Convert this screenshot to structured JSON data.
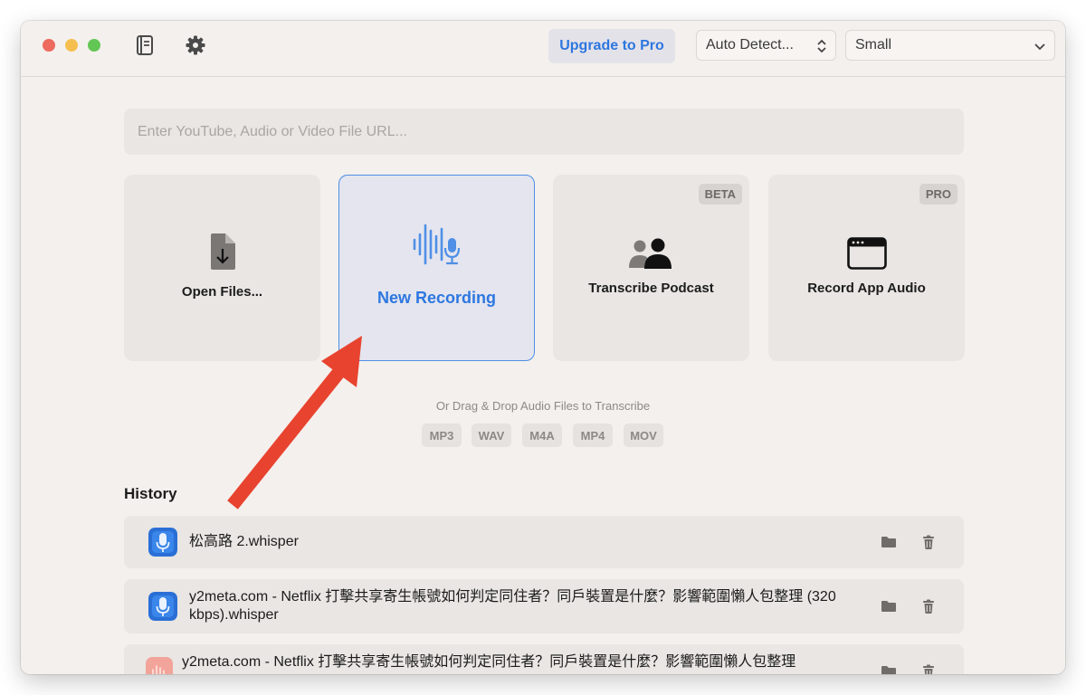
{
  "toolbar": {
    "upgrade_label": "Upgrade to Pro",
    "language_select": "Auto Detect...",
    "model_select": "Small"
  },
  "url_input": {
    "placeholder": "Enter YouTube, Audio or Video File URL..."
  },
  "cards": [
    {
      "label": "Open Files...",
      "icon": "file-download-icon"
    },
    {
      "label": "New Recording",
      "icon": "waveform-mic-icon"
    },
    {
      "label": "Transcribe Podcast",
      "icon": "people-icon",
      "badge": "BETA"
    },
    {
      "label": "Record App Audio",
      "icon": "app-window-icon",
      "badge": "PRO"
    }
  ],
  "drag_hint": "Or Drag & Drop Audio Files to Transcribe",
  "formats": [
    "MP3",
    "WAV",
    "M4A",
    "MP4",
    "MOV"
  ],
  "history": {
    "title": "History",
    "items": [
      {
        "name": "松高路 2.whisper"
      },
      {
        "name": "y2meta.com - Netflix 打擊共享寄生帳號如何判定同住者？同戶裝置是什麼？影響範圍懶人包整理 (320 kbps).whisper"
      },
      {
        "name": "y2meta.com - Netflix 打擊共享寄生帳號如何判定同住者？同戶裝置是什麼？影響範圍懶人包整理"
      }
    ]
  },
  "colors": {
    "accent": "#2d77e0",
    "window_bg": "#f4f0ed",
    "card_bg": "#e9e6e3",
    "annotation_arrow": "#e8432f"
  }
}
